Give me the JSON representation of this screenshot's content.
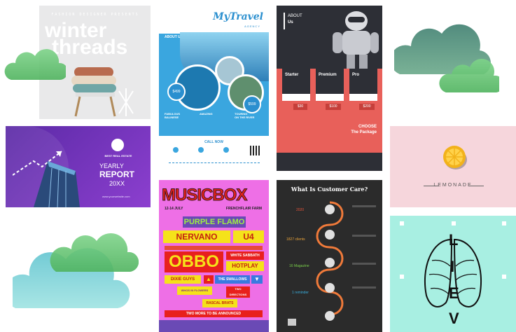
{
  "winter": {
    "subtitle": "FASHION DESIGNER PRESENTS",
    "line1": "winter",
    "line2": "threads"
  },
  "travel": {
    "brand": "MyTravel",
    "brand_sub": "AGENCY",
    "about_title": "ABOUT US",
    "price_1": "$499",
    "price_2": "$599",
    "col_1": "FABULOUS\nBALINESE",
    "col_2": "AMAZING",
    "col_3": "TOURING\nON THE RIVER",
    "call": "CALL NOW"
  },
  "about": {
    "title_line1": "ABOUT",
    "title_line2": "Us",
    "plans": [
      {
        "name": "Starter",
        "price": "$30"
      },
      {
        "name": "Premium",
        "price": "$100"
      },
      {
        "name": "Pro",
        "price": "$200"
      }
    ],
    "choose_1": "CHOOSE",
    "choose_2": "The Package"
  },
  "report": {
    "brand": "BEST REAL ESTATE",
    "line1": "YEARLY",
    "line2": "REPORT",
    "line3": "20XX",
    "url": "www.yourwebsite.com"
  },
  "lemonade": {
    "label": "LEMONADE"
  },
  "music": {
    "title": "MUSICBOX",
    "dates": "12-14 JULY",
    "venue": "FRENCHFLAIR FARM",
    "acts": [
      "PURPLE FLAMO",
      "NERVANO",
      "U4",
      "OBBO",
      "WHITE SABBATH",
      "HOTPLAY",
      "DIXIE GUYS",
      "THE SWALLOWS",
      "WHOS IN FLOWERS",
      "TWO DIRECTIONS",
      "RASCAL BRATS",
      "TWO MORE TO BE ANNOUNCED"
    ]
  },
  "care": {
    "title": "What Is Customer Care?",
    "items": [
      "2020",
      "1827 clients",
      "16 Magazine",
      "1 reminder"
    ]
  },
  "wings": {
    "letters": [
      "L",
      "I",
      "E",
      "V"
    ]
  },
  "colors": {
    "cloud_green": "#5bbf6a",
    "cloud_blue": "#7dd3d8",
    "report_purple": "#7b3fbf",
    "about_coral": "#e8605a",
    "music_pink": "#ee6fe6",
    "care_dark": "#2b2b2b",
    "lemonade_pink": "#f6d6dc",
    "wings_mint": "#a8efe2"
  }
}
